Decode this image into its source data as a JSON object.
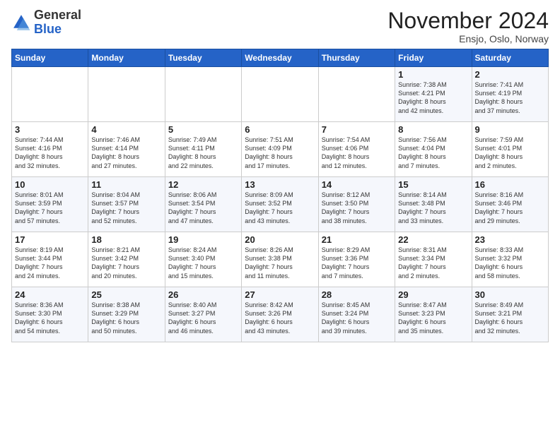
{
  "header": {
    "logo_general": "General",
    "logo_blue": "Blue",
    "title": "November 2024",
    "location": "Ensjo, Oslo, Norway"
  },
  "columns": [
    "Sunday",
    "Monday",
    "Tuesday",
    "Wednesday",
    "Thursday",
    "Friday",
    "Saturday"
  ],
  "weeks": [
    [
      {
        "day": "",
        "info": ""
      },
      {
        "day": "",
        "info": ""
      },
      {
        "day": "",
        "info": ""
      },
      {
        "day": "",
        "info": ""
      },
      {
        "day": "",
        "info": ""
      },
      {
        "day": "1",
        "info": "Sunrise: 7:38 AM\nSunset: 4:21 PM\nDaylight: 8 hours\nand 42 minutes."
      },
      {
        "day": "2",
        "info": "Sunrise: 7:41 AM\nSunset: 4:19 PM\nDaylight: 8 hours\nand 37 minutes."
      }
    ],
    [
      {
        "day": "3",
        "info": "Sunrise: 7:44 AM\nSunset: 4:16 PM\nDaylight: 8 hours\nand 32 minutes."
      },
      {
        "day": "4",
        "info": "Sunrise: 7:46 AM\nSunset: 4:14 PM\nDaylight: 8 hours\nand 27 minutes."
      },
      {
        "day": "5",
        "info": "Sunrise: 7:49 AM\nSunset: 4:11 PM\nDaylight: 8 hours\nand 22 minutes."
      },
      {
        "day": "6",
        "info": "Sunrise: 7:51 AM\nSunset: 4:09 PM\nDaylight: 8 hours\nand 17 minutes."
      },
      {
        "day": "7",
        "info": "Sunrise: 7:54 AM\nSunset: 4:06 PM\nDaylight: 8 hours\nand 12 minutes."
      },
      {
        "day": "8",
        "info": "Sunrise: 7:56 AM\nSunset: 4:04 PM\nDaylight: 8 hours\nand 7 minutes."
      },
      {
        "day": "9",
        "info": "Sunrise: 7:59 AM\nSunset: 4:01 PM\nDaylight: 8 hours\nand 2 minutes."
      }
    ],
    [
      {
        "day": "10",
        "info": "Sunrise: 8:01 AM\nSunset: 3:59 PM\nDaylight: 7 hours\nand 57 minutes."
      },
      {
        "day": "11",
        "info": "Sunrise: 8:04 AM\nSunset: 3:57 PM\nDaylight: 7 hours\nand 52 minutes."
      },
      {
        "day": "12",
        "info": "Sunrise: 8:06 AM\nSunset: 3:54 PM\nDaylight: 7 hours\nand 47 minutes."
      },
      {
        "day": "13",
        "info": "Sunrise: 8:09 AM\nSunset: 3:52 PM\nDaylight: 7 hours\nand 43 minutes."
      },
      {
        "day": "14",
        "info": "Sunrise: 8:12 AM\nSunset: 3:50 PM\nDaylight: 7 hours\nand 38 minutes."
      },
      {
        "day": "15",
        "info": "Sunrise: 8:14 AM\nSunset: 3:48 PM\nDaylight: 7 hours\nand 33 minutes."
      },
      {
        "day": "16",
        "info": "Sunrise: 8:16 AM\nSunset: 3:46 PM\nDaylight: 7 hours\nand 29 minutes."
      }
    ],
    [
      {
        "day": "17",
        "info": "Sunrise: 8:19 AM\nSunset: 3:44 PM\nDaylight: 7 hours\nand 24 minutes."
      },
      {
        "day": "18",
        "info": "Sunrise: 8:21 AM\nSunset: 3:42 PM\nDaylight: 7 hours\nand 20 minutes."
      },
      {
        "day": "19",
        "info": "Sunrise: 8:24 AM\nSunset: 3:40 PM\nDaylight: 7 hours\nand 15 minutes."
      },
      {
        "day": "20",
        "info": "Sunrise: 8:26 AM\nSunset: 3:38 PM\nDaylight: 7 hours\nand 11 minutes."
      },
      {
        "day": "21",
        "info": "Sunrise: 8:29 AM\nSunset: 3:36 PM\nDaylight: 7 hours\nand 7 minutes."
      },
      {
        "day": "22",
        "info": "Sunrise: 8:31 AM\nSunset: 3:34 PM\nDaylight: 7 hours\nand 2 minutes."
      },
      {
        "day": "23",
        "info": "Sunrise: 8:33 AM\nSunset: 3:32 PM\nDaylight: 6 hours\nand 58 minutes."
      }
    ],
    [
      {
        "day": "24",
        "info": "Sunrise: 8:36 AM\nSunset: 3:30 PM\nDaylight: 6 hours\nand 54 minutes."
      },
      {
        "day": "25",
        "info": "Sunrise: 8:38 AM\nSunset: 3:29 PM\nDaylight: 6 hours\nand 50 minutes."
      },
      {
        "day": "26",
        "info": "Sunrise: 8:40 AM\nSunset: 3:27 PM\nDaylight: 6 hours\nand 46 minutes."
      },
      {
        "day": "27",
        "info": "Sunrise: 8:42 AM\nSunset: 3:26 PM\nDaylight: 6 hours\nand 43 minutes."
      },
      {
        "day": "28",
        "info": "Sunrise: 8:45 AM\nSunset: 3:24 PM\nDaylight: 6 hours\nand 39 minutes."
      },
      {
        "day": "29",
        "info": "Sunrise: 8:47 AM\nSunset: 3:23 PM\nDaylight: 6 hours\nand 35 minutes."
      },
      {
        "day": "30",
        "info": "Sunrise: 8:49 AM\nSunset: 3:21 PM\nDaylight: 6 hours\nand 32 minutes."
      }
    ]
  ]
}
